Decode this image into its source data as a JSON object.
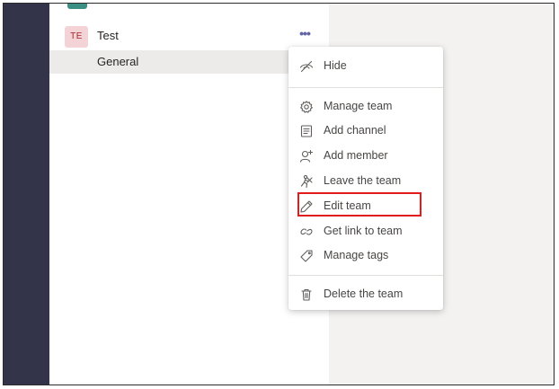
{
  "team": {
    "avatar_initials": "TE",
    "name": "Test",
    "more_options": "•••",
    "channels": [
      {
        "name": "General"
      }
    ]
  },
  "context_menu": {
    "items": [
      {
        "label": "Hide",
        "icon": "hide-icon"
      },
      {
        "label": "Manage team",
        "icon": "gear-icon"
      },
      {
        "label": "Add channel",
        "icon": "channel-icon"
      },
      {
        "label": "Add member",
        "icon": "add-person-icon"
      },
      {
        "label": "Leave the team",
        "icon": "leave-icon"
      },
      {
        "label": "Edit team",
        "icon": "pencil-icon"
      },
      {
        "label": "Get link to team",
        "icon": "link-icon"
      },
      {
        "label": "Manage tags",
        "icon": "tag-icon"
      },
      {
        "label": "Delete the team",
        "icon": "trash-icon"
      }
    ],
    "highlighted_item": "Edit team"
  },
  "colors": {
    "rail": "#33344a",
    "accent": "#6264a7",
    "highlight_box": "#e21c1c",
    "avatar_bg": "#f4d3d6"
  }
}
